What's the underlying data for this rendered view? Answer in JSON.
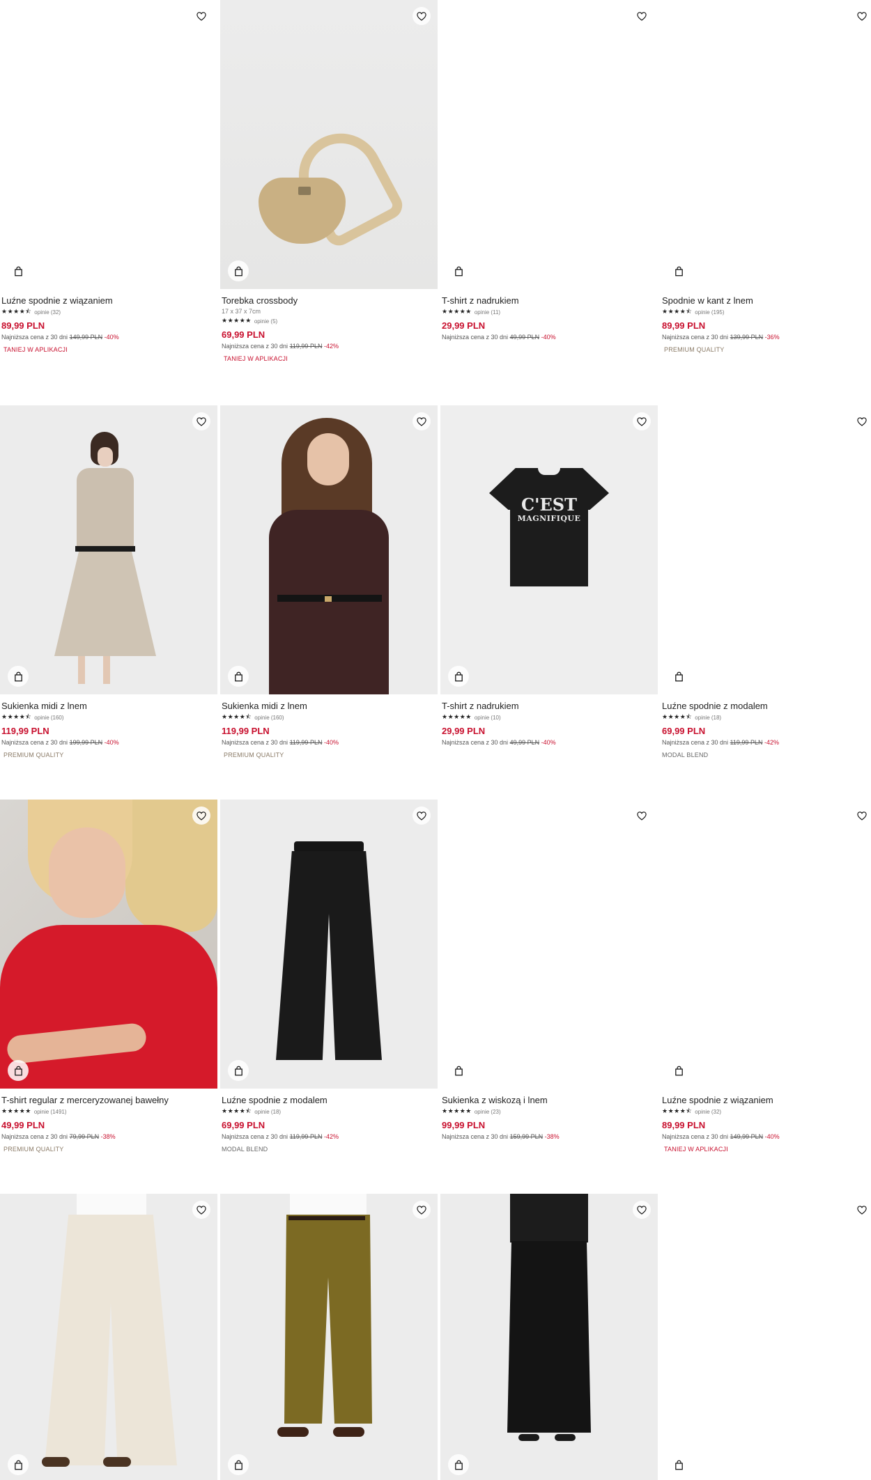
{
  "products": [
    {
      "name": "Luźne spodnie z wiązaniem",
      "stars": "★★★★⯪",
      "reviews": "opinie (32)",
      "price": "89,99 PLN",
      "lowest_label": "Najniższa cena z 30 dni",
      "old_price": "149,99 PLN",
      "discount": "-40%",
      "badge": "TANIEJ W APLIKACJI",
      "badge_type": "app",
      "image": "blank"
    },
    {
      "name": "Torebka crossbody",
      "dims": "17 x 37 x 7cm",
      "stars": "★★★★★",
      "reviews": "opinie (5)",
      "price": "69,99 PLN",
      "lowest_label": "Najniższa cena z 30 dni",
      "old_price": "119,99 PLN",
      "discount": "-42%",
      "badge": "TANIEJ W APLIKACJI",
      "badge_type": "app",
      "image": "bag"
    },
    {
      "name": "T-shirt z nadrukiem",
      "stars": "★★★★★",
      "reviews": "opinie (11)",
      "price": "29,99 PLN",
      "lowest_label": "Najniższa cena z 30 dni",
      "old_price": "49,99 PLN",
      "discount": "-40%",
      "badge": "",
      "badge_type": "",
      "image": "blank"
    },
    {
      "name": "Spodnie w kant z lnem",
      "stars": "★★★★⯪",
      "reviews": "opinie (195)",
      "price": "89,99 PLN",
      "lowest_label": "Najniższa cena z 30 dni",
      "old_price": "139,99 PLN",
      "discount": "-36%",
      "badge": "PREMIUM QUALITY",
      "badge_type": "premium",
      "image": "blank"
    },
    {
      "name": "Sukienka midi z lnem",
      "stars": "★★★★⯪",
      "reviews": "opinie (160)",
      "price": "119,99 PLN",
      "lowest_label": "Najniższa cena z 30 dni",
      "old_price": "199,99 PLN",
      "discount": "-40%",
      "badge": "PREMIUM QUALITY",
      "badge_type": "premium",
      "image": "dress-beige"
    },
    {
      "name": "Sukienka midi z lnem",
      "stars": "★★★★⯪",
      "reviews": "opinie (160)",
      "price": "119,99 PLN",
      "lowest_label": "Najniższa cena z 30 dni",
      "old_price": "119,99 PLN",
      "discount": "-40%",
      "badge": "PREMIUM QUALITY",
      "badge_type": "premium",
      "image": "dress-brown"
    },
    {
      "name": "T-shirt z nadrukiem",
      "stars": "★★★★★",
      "reviews": "opinie (10)",
      "price": "29,99 PLN",
      "lowest_label": "Najniższa cena z 30 dni",
      "old_price": "49,99 PLN",
      "discount": "-40%",
      "badge": "",
      "badge_type": "",
      "image": "tee",
      "print_line1": "C'EST",
      "print_line2": "MAGNIFIQUE"
    },
    {
      "name": "Luźne spodnie z modalem",
      "stars": "★★★★⯪",
      "reviews": "opinie (18)",
      "price": "69,99 PLN",
      "lowest_label": "Najniższa cena z 30 dni",
      "old_price": "119,99 PLN",
      "discount": "-42%",
      "badge": "MODAL BLEND",
      "badge_type": "modal",
      "image": "blank"
    },
    {
      "name": "T-shirt regular z merceryzowanej bawełny",
      "stars": "★★★★★",
      "reviews": "opinie (1491)",
      "price": "49,99 PLN",
      "lowest_label": "Najniższa cena z 30 dni",
      "old_price": "79,99 PLN",
      "discount": "-38%",
      "badge": "PREMIUM QUALITY",
      "badge_type": "premium",
      "image": "red"
    },
    {
      "name": "Luźne spodnie z modalem",
      "stars": "★★★★⯪",
      "reviews": "opinie (18)",
      "price": "69,99 PLN",
      "lowest_label": "Najniższa cena z 30 dni",
      "old_price": "119,99 PLN",
      "discount": "-42%",
      "badge": "MODAL BLEND",
      "badge_type": "modal",
      "image": "pants-black"
    },
    {
      "name": "Sukienka z wiskozą i lnem",
      "stars": "★★★★★",
      "reviews": "opinie (23)",
      "price": "99,99 PLN",
      "lowest_label": "Najniższa cena z 30 dni",
      "old_price": "159,99 PLN",
      "discount": "-38%",
      "badge": "",
      "badge_type": "",
      "image": "blank"
    },
    {
      "name": "Luźne spodnie z wiązaniem",
      "stars": "★★★★⯪",
      "reviews": "opinie (32)",
      "price": "89,99 PLN",
      "lowest_label": "Najniższa cena z 30 dni",
      "old_price": "149,99 PLN",
      "discount": "-40%",
      "badge": "TANIEJ W APLIKACJI",
      "badge_type": "app",
      "image": "blank"
    },
    {
      "image": "pants-cream"
    },
    {
      "image": "pants-olive"
    },
    {
      "image": "skirt-black"
    },
    {
      "image": "blank"
    }
  ],
  "colors": {
    "price": "#c8102e",
    "premium_badge": "#8a7a66",
    "text": "#222222"
  }
}
